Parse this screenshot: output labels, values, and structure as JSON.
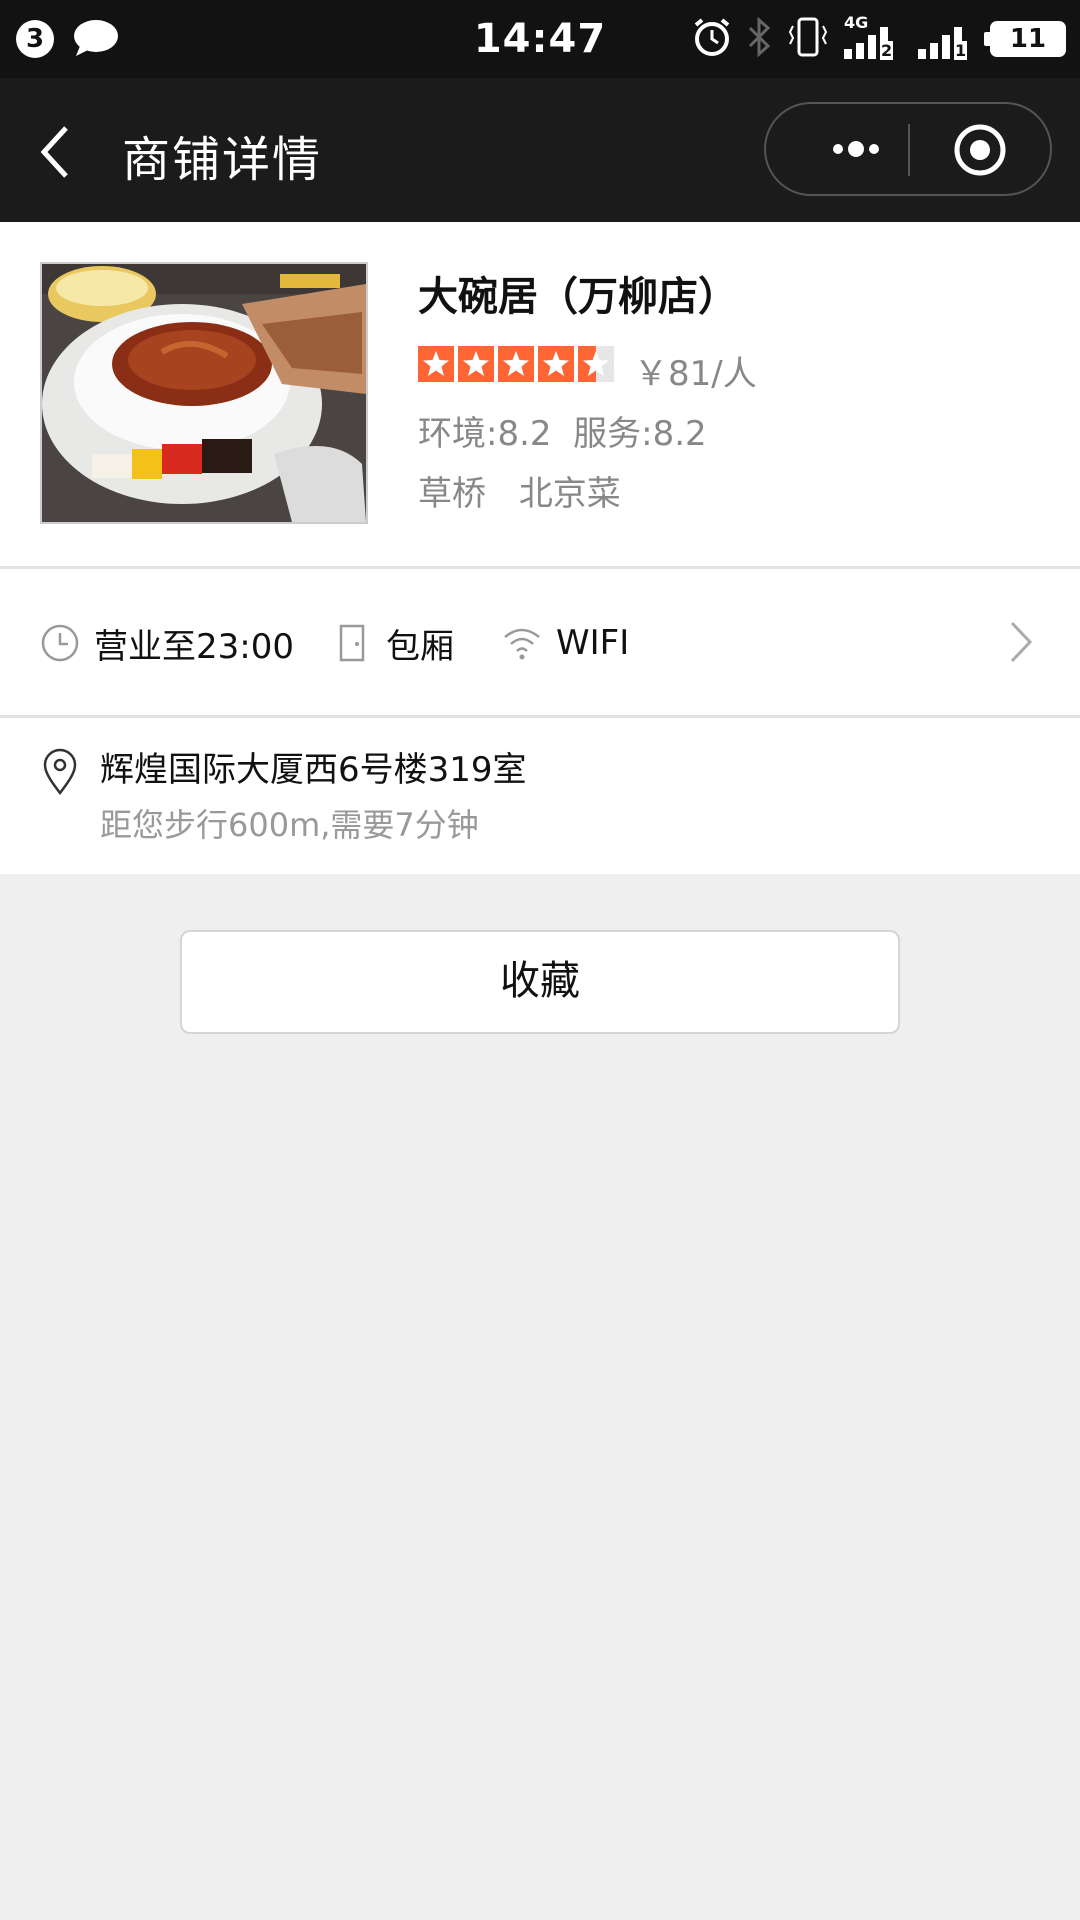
{
  "status_bar": {
    "notification_count": "3",
    "time": "14:47",
    "network": "4G",
    "sim1": "2",
    "sim2": "1",
    "battery": "11",
    "icons": [
      "chat-bubble-icon",
      "alarm-icon",
      "bluetooth-icon",
      "vibrate-icon",
      "signal-icon",
      "battery-icon"
    ]
  },
  "nav": {
    "back_icon": "back-chevron-icon",
    "title": "商铺详情",
    "more_icon": "more-dots-icon",
    "target_icon": "target-circle-icon"
  },
  "shop": {
    "name": "大碗居（万柳店）",
    "rating": 4.5,
    "rating_max": 5,
    "price": "￥81/人",
    "environment_score": "环境:8.2",
    "service_score": "服务:8.2",
    "area": "草桥",
    "cuisine": "北京菜",
    "star_color": "#ff6633"
  },
  "facilities": {
    "hours": "营业至23:00",
    "private_room": "包厢",
    "wifi": "WIFI",
    "icons": [
      "clock-icon",
      "door-icon",
      "wifi-icon",
      "chevron-right-icon"
    ]
  },
  "address": {
    "line": "辉煌国际大厦西6号楼319室",
    "distance": "距您步行600m,需要7分钟",
    "icon": "location-pin-icon"
  },
  "actions": {
    "favorite_label": "收藏"
  }
}
